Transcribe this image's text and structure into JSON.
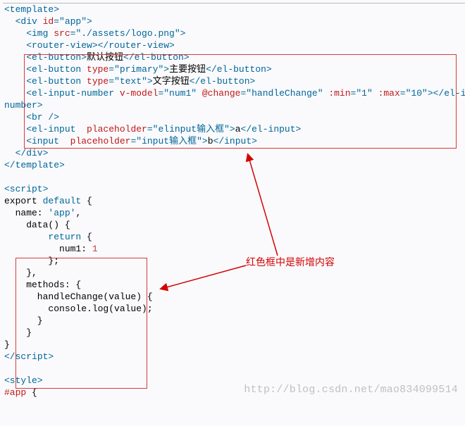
{
  "annotation": "红色框中是新增内容",
  "watermark": "http://blog.csdn.net/mao834099514",
  "lines": {
    "l1": "<template>",
    "l2": "  <div id=\"app\">",
    "l3_a": "    <img ",
    "l3_attr": "src",
    "l3_val": "\"./assets/logo.png\"",
    "l3_c": ">",
    "l4": "    <router-view></router-view>",
    "l5": "    <el-button>默认按钮</el-button>",
    "l6_open": "    <el-button ",
    "l6_attr": "type",
    "l6_val": "\"primary\"",
    "l6_txt": "主要按钮",
    "l6_close": "</el-button>",
    "l7_open": "    <el-button ",
    "l7_attr": "type",
    "l7_val": "\"text\"",
    "l7_txt": "文字按钮",
    "l7_close": "</el-button>",
    "l8_open": "    <el-input-number ",
    "l8_a1": "v-model",
    "l8_v1": "\"num1\"",
    "l8_a2": "@change",
    "l8_v2": "\"handleChange\"",
    "l8_a3": ":min",
    "l8_v3": "\"1\"",
    "l8_a4": ":max",
    "l8_v4": "\"10\"",
    "l8_close": "></el-input-",
    "l8b": "number>",
    "l9": "    <br />",
    "l10_open": "    <el-input ",
    "l10_a1": "placeholder",
    "l10_v1": "\"elinput输入框\"",
    "l10_txt": "a",
    "l10_close": "</el-input>",
    "l11_open": "    <input ",
    "l11_a1": "placeholder",
    "l11_v1": "\"input输入框\"",
    "l11_txt": "b",
    "l11_close": "</input>",
    "l12": "  </div>",
    "l13": "</template>",
    "l14": "<script>",
    "l15": "export default {",
    "l16_a": "  name: ",
    "l16_b": "'app'",
    "l16_c": ",",
    "l17": "    data() {",
    "l18": "        return {",
    "l19_a": "          num1: ",
    "l19_b": "1",
    "l20": "        };",
    "l21": "    },",
    "l22": "    methods: {",
    "l23": "      handleChange(value) {",
    "l24": "        console.log(value);",
    "l25": "      }",
    "l26": "    }",
    "l27": "}",
    "l28": "</scr",
    "l28b": "ipt>",
    "l29": "<style>",
    "l30": "#app {"
  }
}
